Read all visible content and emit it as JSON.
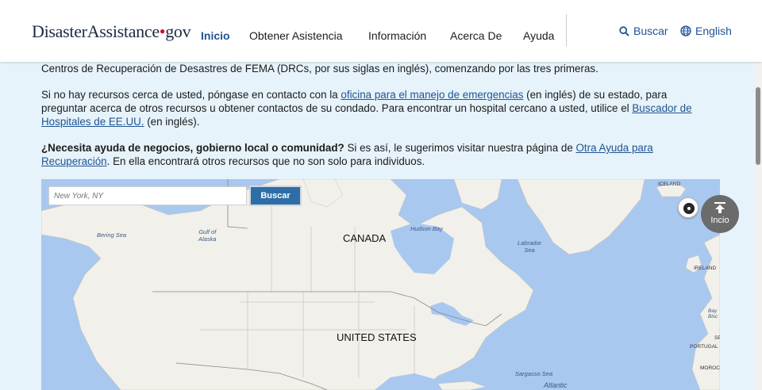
{
  "header": {
    "logo": {
      "part1": "Disaster",
      "part2": "Assistance",
      "dot": "•",
      "part3": "gov"
    },
    "nav": [
      {
        "label": "Inicio",
        "active": true
      },
      {
        "label": "Obtener Asistencia"
      },
      {
        "label": "Información"
      },
      {
        "label": "Acerca De"
      },
      {
        "label": "Ayuda"
      }
    ],
    "search_label": "Buscar",
    "language_label": "English",
    "accent_color": "#205493"
  },
  "content": {
    "p1": "Centros de Recuperación de Desastres de FEMA (DRCs, por sus siglas en inglés), comenzando por las tres primeras.",
    "p2": {
      "t1": "Si no hay recursos cerca de usted, póngase en contacto con la ",
      "link1": "oficina para el manejo de emergencias",
      "t2": " (en inglés) de su estado, para preguntar acerca de otros recursos u obtener contactos de su condado. Para encontrar un hospital cercano a usted, utilice el ",
      "link2": "Buscador de Hospitales de EE.UU.",
      "t3": " (en inglés)."
    },
    "p3": {
      "bold": "¿Necesita ayuda de negocios, gobierno local o comunidad?",
      "t1": " Si es así, le sugerimos visitar nuestra página de ",
      "link": "Otra Ayuda para Recuperación",
      "t2": ". En ella encontrará otros recursos que no son solo para individuos."
    }
  },
  "map": {
    "search_placeholder": "New York, NY",
    "search_button": "Buscar",
    "countries": [
      "CANADA",
      "UNITED STATES"
    ],
    "seas": {
      "bering": "Bering Sea",
      "alaska": "Gulf of\nAlaska",
      "hudson": "Hudson Bay",
      "labrador": "Labrador\nSea",
      "sargasso": "Sargasso Sea",
      "atlantic": "Atlantic"
    },
    "places": {
      "iceland": "ICELAND",
      "ireland": "IRELAND",
      "bay": "Bay\nBisc",
      "portugal": "PORTUGAL",
      "sp": "SP",
      "morocco": "MOROC"
    },
    "water_color": "#a8c8f0",
    "land_color": "#f2f0ea"
  },
  "back_to_top_label": "Incio"
}
